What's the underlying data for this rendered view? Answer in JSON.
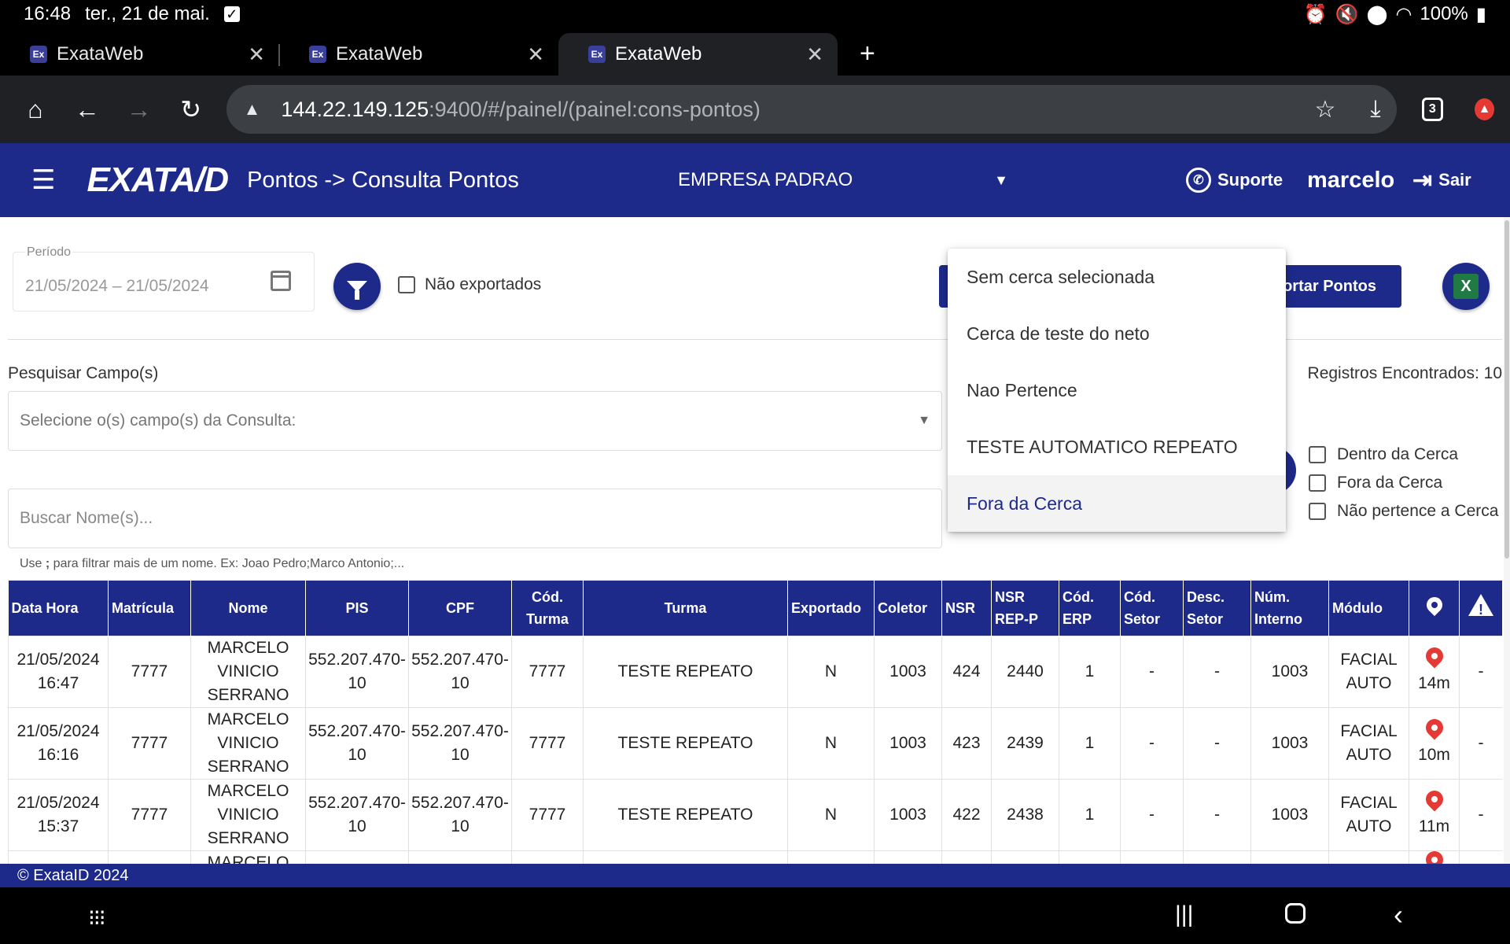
{
  "status": {
    "time": "16:48",
    "date": "ter., 21 de mai.",
    "battery": "100%"
  },
  "browser": {
    "tabs": [
      {
        "title": "ExataWeb",
        "favicon": "Ex",
        "active": false
      },
      {
        "title": "ExataWeb",
        "favicon": "Ex",
        "active": false
      },
      {
        "title": "ExataWeb",
        "favicon": "Ex",
        "active": true
      }
    ],
    "url_host": "144.22.149.125",
    "url_rest": ":9400/#/painel/(painel:cons-pontos)",
    "tab_count": "3"
  },
  "header": {
    "logo": "EXATA/D",
    "title": "Pontos -> Consulta Pontos",
    "company": "EMPRESA PADRAO",
    "support": "Suporte",
    "user": "marcelo",
    "logout": "Sair"
  },
  "filters": {
    "periodo_label": "Período",
    "periodo_value": "21/05/2024 – 21/05/2024",
    "nao_exportados": "Não exportados",
    "exportar_label": "ortar Pontos"
  },
  "search": {
    "campos_label": "Pesquisar Campo(s)",
    "campos_placeholder": "Selecione o(s) campo(s) da Consulta:",
    "registros": "Registros Encontrados: 10",
    "nomes_placeholder": "Buscar Nome(s)...",
    "hint_prefix": "Use ",
    "hint_sep": ";",
    "hint_suffix": " para filtrar mais de um nome. Ex: Joao Pedro;Marco Antonio;..."
  },
  "cerca_options": [
    {
      "label": "Dentro da Cerca"
    },
    {
      "label": "Fora da Cerca"
    },
    {
      "label": "Não pertence a Cerca"
    }
  ],
  "dropdown": {
    "items": [
      {
        "label": "Sem cerca selecionada"
      },
      {
        "label": "Cerca de teste do neto"
      },
      {
        "label": "Nao Pertence"
      },
      {
        "label": "TESTE AUTOMATICO REPEATO"
      },
      {
        "label": "Fora da Cerca",
        "selected": true
      }
    ]
  },
  "table": {
    "headers": {
      "data_hora": "Data Hora",
      "matricula": "Matrícula",
      "nome": "Nome",
      "pis": "PIS",
      "cpf": "CPF",
      "cod_turma": "Cód. Turma",
      "turma": "Turma",
      "exportado": "Exportado",
      "coletor": "Coletor",
      "nsr": "NSR",
      "nsr_rep_p": "NSR REP-P",
      "cod_erp": "Cód. ERP",
      "cod_setor": "Cód. Setor",
      "desc_setor": "Desc. Setor",
      "num_interno": "Núm. Interno",
      "modulo": "Módulo"
    },
    "rows": [
      {
        "data_hora": "21/05/2024 16:47",
        "matricula": "7777",
        "nome": "MARCELO VINICIO SERRANO",
        "pis": "552.207.470-10",
        "cpf": "552.207.470-10",
        "cod_turma": "7777",
        "turma": "TESTE REPEATO",
        "exportado": "N",
        "coletor": "1003",
        "nsr": "424",
        "nsr_rep_p": "2440",
        "cod_erp": "1",
        "cod_setor": "-",
        "desc_setor": "-",
        "num_interno": "1003",
        "modulo": "FACIAL AUTO",
        "dist": "14m",
        "alerta": "-"
      },
      {
        "data_hora": "21/05/2024 16:16",
        "matricula": "7777",
        "nome": "MARCELO VINICIO SERRANO",
        "pis": "552.207.470-10",
        "cpf": "552.207.470-10",
        "cod_turma": "7777",
        "turma": "TESTE REPEATO",
        "exportado": "N",
        "coletor": "1003",
        "nsr": "423",
        "nsr_rep_p": "2439",
        "cod_erp": "1",
        "cod_setor": "-",
        "desc_setor": "-",
        "num_interno": "1003",
        "modulo": "FACIAL AUTO",
        "dist": "10m",
        "alerta": "-"
      },
      {
        "data_hora": "21/05/2024 15:37",
        "matricula": "7777",
        "nome": "MARCELO VINICIO SERRANO",
        "pis": "552.207.470-10",
        "cpf": "552.207.470-10",
        "cod_turma": "7777",
        "turma": "TESTE REPEATO",
        "exportado": "N",
        "coletor": "1003",
        "nsr": "422",
        "nsr_rep_p": "2438",
        "cod_erp": "1",
        "cod_setor": "-",
        "desc_setor": "-",
        "num_interno": "1003",
        "modulo": "FACIAL AUTO",
        "dist": "11m",
        "alerta": "-"
      },
      {
        "data_hora": "",
        "matricula": "",
        "nome": "MARCELO",
        "pis": "",
        "cpf": "",
        "cod_turma": "",
        "turma": "",
        "exportado": "",
        "coletor": "",
        "nsr": "",
        "nsr_rep_p": "",
        "cod_erp": "",
        "cod_setor": "",
        "desc_setor": "",
        "num_interno": "",
        "modulo": "",
        "dist": "",
        "alerta": ""
      }
    ]
  },
  "footer": {
    "text": "© ExataID 2024"
  },
  "colors": {
    "primary": "#1e2a8a",
    "pin": "#e53935",
    "excel": "#1f7a43"
  }
}
